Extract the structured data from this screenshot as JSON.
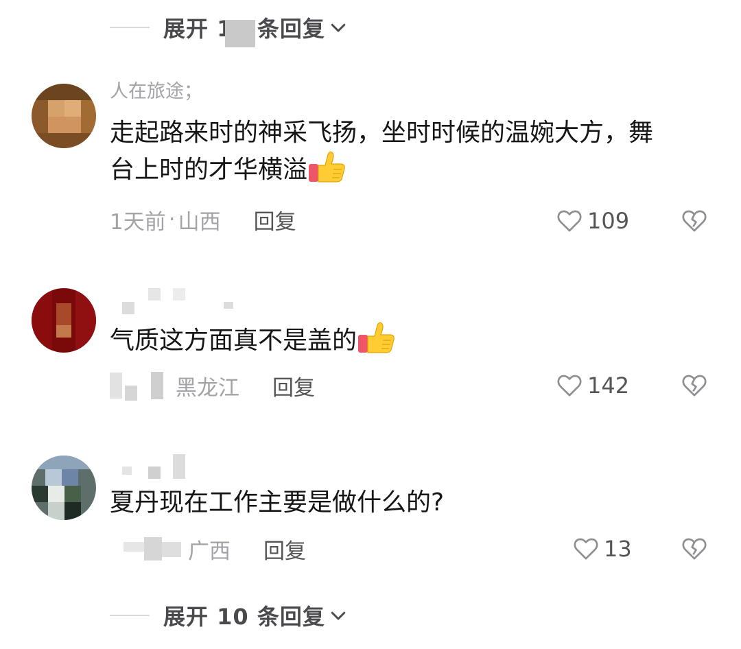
{
  "top_expand": {
    "label": "展开 10 条回复"
  },
  "comments": [
    {
      "username": "人在旅途；",
      "text": "走起路来时的神采飞扬，坐时时候的温婉大方，舞台上时的才华横溢",
      "time": "1天前",
      "dot": "·",
      "location": "山西",
      "reply_label": "回复",
      "likes": "109",
      "avatar_icon": "avatar-image",
      "emoji": "thumbs-up-icon"
    },
    {
      "username": "",
      "text": "气质这方面真不是盖的",
      "time": "",
      "dot": "",
      "location": "黑龙江",
      "reply_label": "回复",
      "likes": "142",
      "avatar_icon": "avatar-image",
      "emoji": "thumbs-up-icon"
    },
    {
      "username": "",
      "text": "夏丹现在工作主要是做什么的?",
      "time": "",
      "dot": "",
      "location": "广西",
      "reply_label": "回复",
      "likes": "13",
      "avatar_icon": "avatar-image"
    }
  ],
  "bottom_expand": {
    "label": "展开 10 条回复"
  },
  "colors": {
    "meta_gray": "#a3a3a8",
    "text": "#161616",
    "reply": "#555558"
  }
}
